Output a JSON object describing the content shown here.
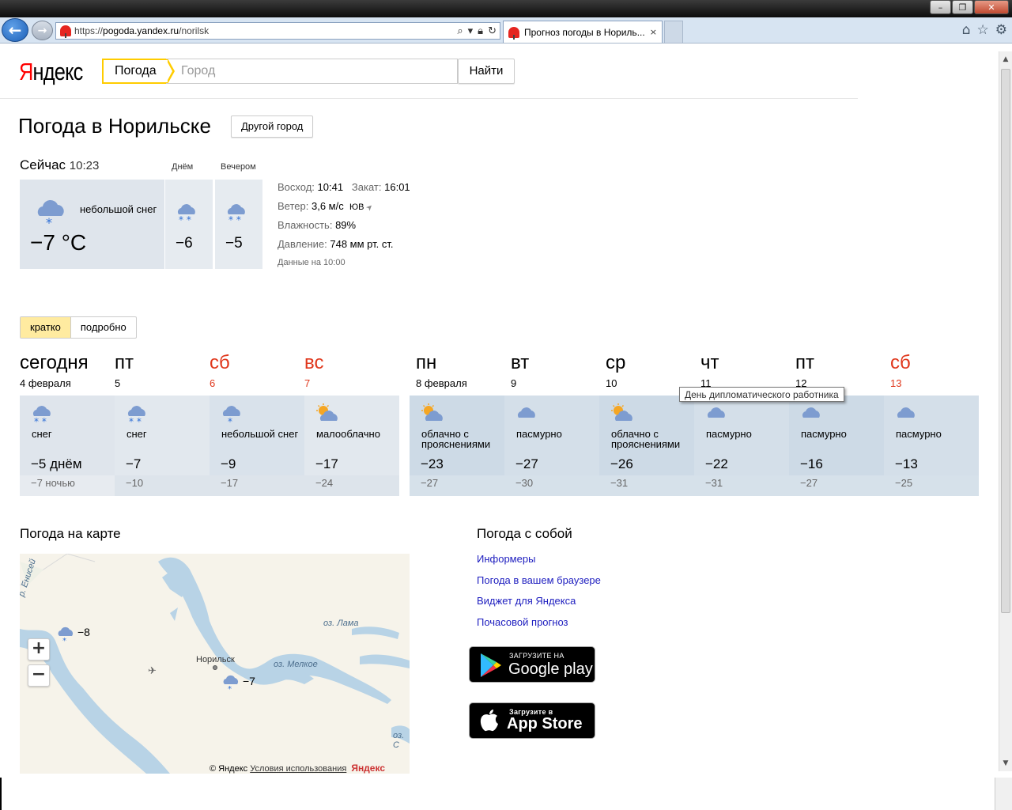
{
  "browser": {
    "url_prefix": "https://",
    "url_host": "pogoda.yandex.ru",
    "url_path": "/norilsk",
    "tab_title": "Прогноз погоды в Нориль...",
    "close_tab": "×"
  },
  "header": {
    "logo_first": "Я",
    "logo_rest": "ндекс",
    "service_tab": "Погода",
    "search_placeholder": "Город",
    "find_button": "Найти"
  },
  "page": {
    "title": "Погода в Норильске",
    "other_city_button": "Другой город"
  },
  "current": {
    "now_label": "Сейчас",
    "time": "10:23",
    "day_label": "Днём",
    "evening_label": "Вечером",
    "description": "небольшой снег",
    "temperature": "−7 °C",
    "day_temp": "−6",
    "evening_temp": "−5",
    "sunrise_label": "Восход:",
    "sunrise": "10:41",
    "sunset_label": "Закат:",
    "sunset": "16:01",
    "wind_label": "Ветер:",
    "wind_speed": "3,6 м/с",
    "wind_dir": "ЮВ",
    "humidity_label": "Влажность:",
    "humidity": "89%",
    "pressure_label": "Давление:",
    "pressure": "748 мм рт. ст.",
    "data_time": "Данные на 10:00"
  },
  "view_switch": {
    "brief": "кратко",
    "detailed": "подробно"
  },
  "forecast": [
    {
      "day": "сегодня",
      "date": "4 февраля",
      "weekend": false,
      "icon": "snow-icon",
      "desc": "снег",
      "day_temp": "−5 днём",
      "night_temp": "−7 ночью"
    },
    {
      "day": "пт",
      "date": "5",
      "weekend": false,
      "icon": "snow-icon",
      "desc": "снег",
      "day_temp": "−7",
      "night_temp": "−10"
    },
    {
      "day": "сб",
      "date": "6",
      "weekend": true,
      "icon": "light-snow-icon",
      "desc": "небольшой снег",
      "day_temp": "−9",
      "night_temp": "−17"
    },
    {
      "day": "вс",
      "date": "7",
      "weekend": true,
      "icon": "partly-cloudy-icon",
      "desc": "малооблачно",
      "day_temp": "−17",
      "night_temp": "−24"
    },
    {
      "day": "пн",
      "date": "8 февраля",
      "weekend": false,
      "icon": "partly-cloudy-icon",
      "desc": "облачно с прояснениями",
      "day_temp": "−23",
      "night_temp": "−27"
    },
    {
      "day": "вт",
      "date": "9",
      "weekend": false,
      "icon": "overcast-icon",
      "desc": "пасмурно",
      "day_temp": "−27",
      "night_temp": "−30"
    },
    {
      "day": "ср",
      "date": "10",
      "weekend": false,
      "icon": "partly-cloudy-icon",
      "desc": "облачно с прояснениями",
      "day_temp": "−26",
      "night_temp": "−31"
    },
    {
      "day": "чт",
      "date": "11",
      "weekend": false,
      "icon": "overcast-icon",
      "desc": "пасмурно",
      "day_temp": "−22",
      "night_temp": "−31"
    },
    {
      "day": "пт",
      "date": "12",
      "weekend": false,
      "icon": "overcast-icon",
      "desc": "пасмурно",
      "day_temp": "−16",
      "night_temp": "−27"
    },
    {
      "day": "сб",
      "date": "13",
      "weekend": true,
      "icon": "overcast-icon",
      "desc": "пасмурно",
      "day_temp": "−13",
      "night_temp": "−25"
    }
  ],
  "tooltip": "День дипломатического работника",
  "map": {
    "title": "Погода на карте",
    "zoom_in": "+",
    "zoom_out": "−",
    "city": "Норильск",
    "river": "р. Енисей",
    "lake_lama": "оз. Лама",
    "lake_melkoe": "оз. Мелкое",
    "lake_cut": "оз. С",
    "temp_west": "−8",
    "temp_city": "−7",
    "copyright": "© Яндекс",
    "terms": "Условия использования",
    "map_logo": "Яндекс"
  },
  "with_you": {
    "title": "Погода с собой",
    "links": [
      "Информеры",
      "Погода в вашем браузере",
      "Виджет для Яндекса",
      "Почасовой прогноз"
    ]
  },
  "stores": {
    "google_small": "ЗАГРУЗИТЕ НА",
    "google_big": "Google play",
    "apple_small": "Загрузите в",
    "apple_big": "App Store"
  },
  "colors": {
    "accent_yellow": "#ffcc00",
    "weekend_red": "#e0371c",
    "link_blue": "#2020c0",
    "cell_today": "#dfe5ec",
    "cell_workdays": "#cfdbe6",
    "cell_weekend": "#d5e0ea"
  }
}
